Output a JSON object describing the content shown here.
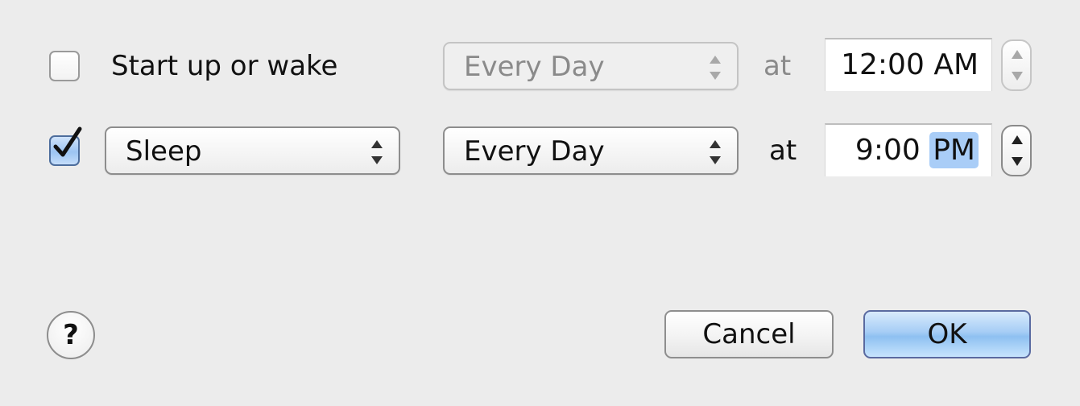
{
  "schedule": {
    "rows": [
      {
        "enabled": false,
        "action_label": "Start up or wake",
        "frequency": "Every Day",
        "at_label": "at",
        "time": {
          "value": "12:00",
          "ampm": "AM"
        },
        "controls_enabled": false
      },
      {
        "enabled": true,
        "action_label": "Sleep",
        "frequency": "Every Day",
        "at_label": "at",
        "time": {
          "value": "9:00",
          "ampm": "PM",
          "selected_segment": "PM"
        },
        "controls_enabled": true
      }
    ]
  },
  "footer": {
    "help_label": "?",
    "cancel_label": "Cancel",
    "ok_label": "OK"
  },
  "colors": {
    "background": "#ececec",
    "accent": "#a9cdf7",
    "default_button": "#8ec0f1"
  }
}
